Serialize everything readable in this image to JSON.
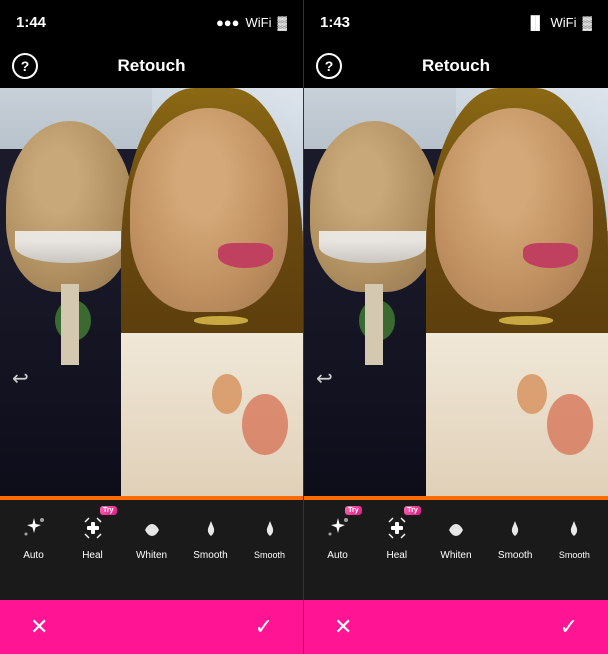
{
  "screens": [
    {
      "id": "left",
      "statusBar": {
        "time": "1:44",
        "hasLocationIcon": true
      },
      "header": {
        "title": "Retouch",
        "helpLabel": "?"
      },
      "tools": [
        {
          "id": "auto",
          "label": "Auto",
          "icon": "sparkle",
          "hasTry": false,
          "selected": false
        },
        {
          "id": "heal",
          "label": "Heal",
          "icon": "bandage",
          "hasTry": true,
          "selected": false
        },
        {
          "id": "whiten",
          "label": "Whiten",
          "icon": "lips",
          "hasTry": false,
          "selected": false
        },
        {
          "id": "smooth",
          "label": "Smooth",
          "icon": "droplet",
          "hasTry": false,
          "selected": false
        },
        {
          "id": "smooth2",
          "label": "Smooth",
          "icon": "droplet2",
          "hasTry": false,
          "selected": false
        }
      ],
      "cancelLabel": "✕",
      "confirmLabel": "✓"
    },
    {
      "id": "right",
      "statusBar": {
        "time": "1:43",
        "hasLocationIcon": true
      },
      "header": {
        "title": "Retouch",
        "helpLabel": "?"
      },
      "tools": [
        {
          "id": "auto",
          "label": "Auto",
          "icon": "sparkle",
          "hasTry": true,
          "selected": false
        },
        {
          "id": "heal",
          "label": "Heal",
          "icon": "bandage",
          "hasTry": true,
          "selected": false
        },
        {
          "id": "whiten",
          "label": "Whiten",
          "icon": "lips",
          "hasTry": false,
          "selected": false
        },
        {
          "id": "smooth",
          "label": "Smooth",
          "icon": "droplet",
          "hasTry": false,
          "selected": false
        },
        {
          "id": "smooth2",
          "label": "Smooth",
          "icon": "droplet2",
          "hasTry": false,
          "selected": false
        }
      ],
      "cancelLabel": "✕",
      "confirmLabel": "✓"
    }
  ],
  "colors": {
    "background": "#000000",
    "topBar": "#000000",
    "accentBar": "#FF6B00",
    "controlsBg": "#1a1a1a",
    "actionBar": "#ff1493",
    "textWhite": "#ffffff"
  }
}
